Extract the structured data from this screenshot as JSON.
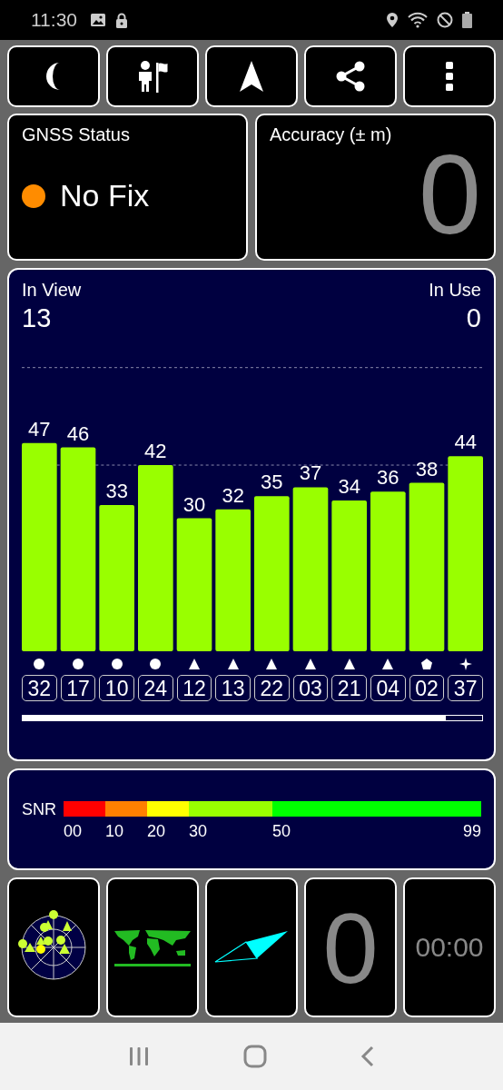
{
  "status_bar": {
    "time": "11:30"
  },
  "gnss_status": {
    "title": "GNSS Status",
    "fix": "No Fix",
    "color": "#ff8c00"
  },
  "accuracy": {
    "title": "Accuracy (± m)",
    "value": "0"
  },
  "satellites_panel": {
    "in_view_label": "In View",
    "in_view": "13",
    "in_use_label": "In Use",
    "in_use": "0",
    "chart_data": {
      "type": "bar",
      "categories": [
        "32",
        "17",
        "10",
        "24",
        "12",
        "13",
        "22",
        "03",
        "21",
        "04",
        "02",
        "37"
      ],
      "series": [
        {
          "color": "#99ff00",
          "values": [
            47,
            46,
            33,
            42,
            30,
            32,
            35,
            37,
            34,
            36,
            38,
            44
          ]
        }
      ],
      "data_labels": true
    },
    "markers": [
      {
        "kind": "circle"
      },
      {
        "kind": "circle"
      },
      {
        "kind": "circle"
      },
      {
        "kind": "circle"
      },
      {
        "kind": "triangle"
      },
      {
        "kind": "triangle"
      },
      {
        "kind": "triangle"
      },
      {
        "kind": "triangle"
      },
      {
        "kind": "triangle"
      },
      {
        "kind": "triangle"
      },
      {
        "kind": "pentagon"
      },
      {
        "kind": "star"
      }
    ]
  },
  "snr_legend": {
    "label": "SNR",
    "end_label": "99",
    "segments": [
      {
        "label": "00",
        "color": "#ff0000"
      },
      {
        "label": "10",
        "color": "#ff8000"
      },
      {
        "label": "20",
        "color": "#ffff00"
      },
      {
        "label": "30",
        "color": "#99ff00"
      },
      {
        "label": "50",
        "color": "#00ff00"
      }
    ]
  },
  "tiles": [
    {
      "kind": "sky-plot"
    },
    {
      "kind": "world-map"
    },
    {
      "kind": "compass"
    },
    {
      "kind": "number",
      "text": "0"
    },
    {
      "kind": "timer",
      "text": "00:00"
    }
  ]
}
